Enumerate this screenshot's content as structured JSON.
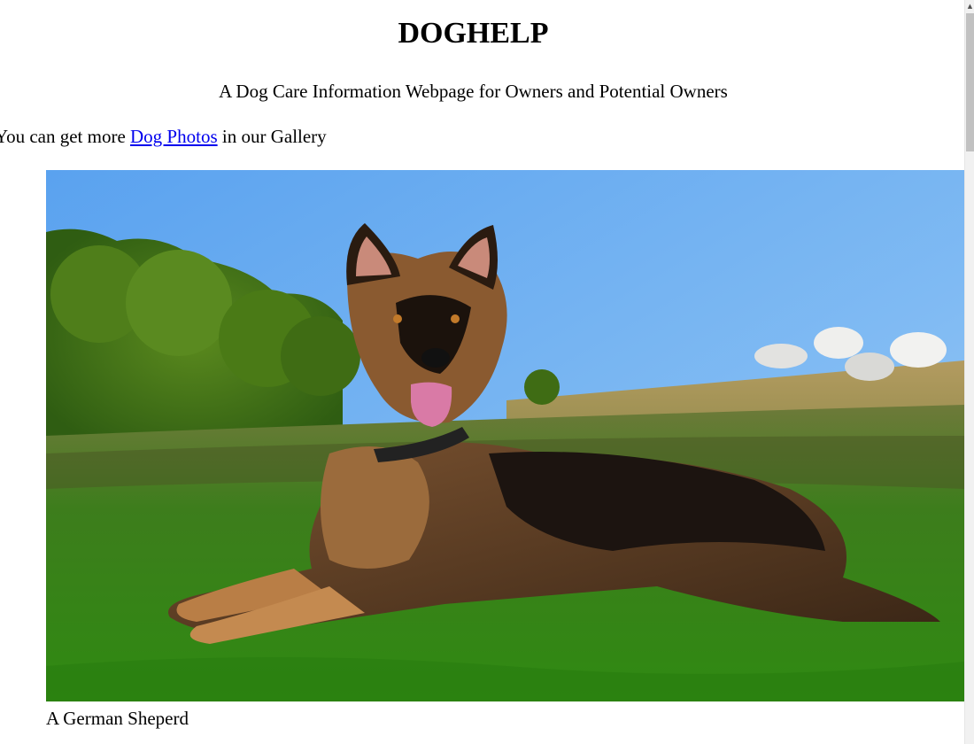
{
  "header": {
    "title": "DOGHELP",
    "subtitle": "A Dog Care Information Webpage for Owners and Potential Owners"
  },
  "intro": {
    "before_link": "You can get more ",
    "link_text": "Dog Photos",
    "after_link": " in our Gallery"
  },
  "figure": {
    "caption": "A German Sheperd"
  },
  "colors": {
    "link": "#0000ee",
    "sky": "#5aa6f0",
    "grass": "#3f8a1f"
  },
  "scrollbar": {
    "up_arrow": "▲"
  }
}
